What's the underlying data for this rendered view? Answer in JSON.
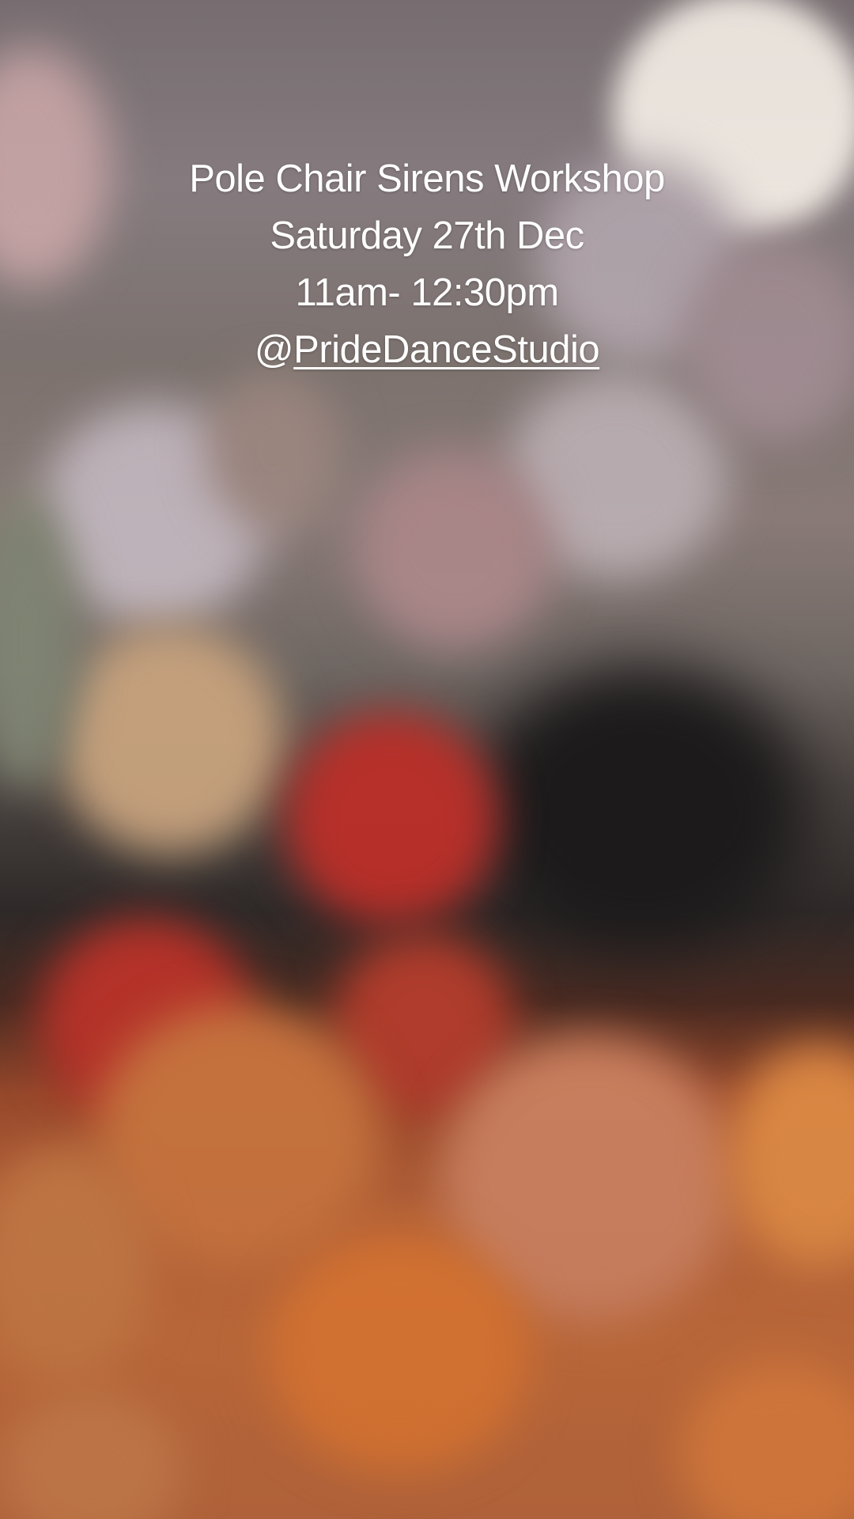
{
  "caption": {
    "title": "Pole Chair Sirens Workshop",
    "date": "Saturday 27th Dec",
    "time": "11am- 12:30pm",
    "mention_prefix": "@",
    "mention_handle": "PrideDanceStudio"
  },
  "colors": {
    "text": "#ffffff",
    "bokeh_white": "#f3ece6",
    "bokeh_lavender": "#b9aeb5",
    "bokeh_pink": "#b98f91",
    "bokeh_cream": "#cdb08e",
    "bokeh_red": "#b82a22",
    "bokeh_orange": "#d9783d"
  }
}
